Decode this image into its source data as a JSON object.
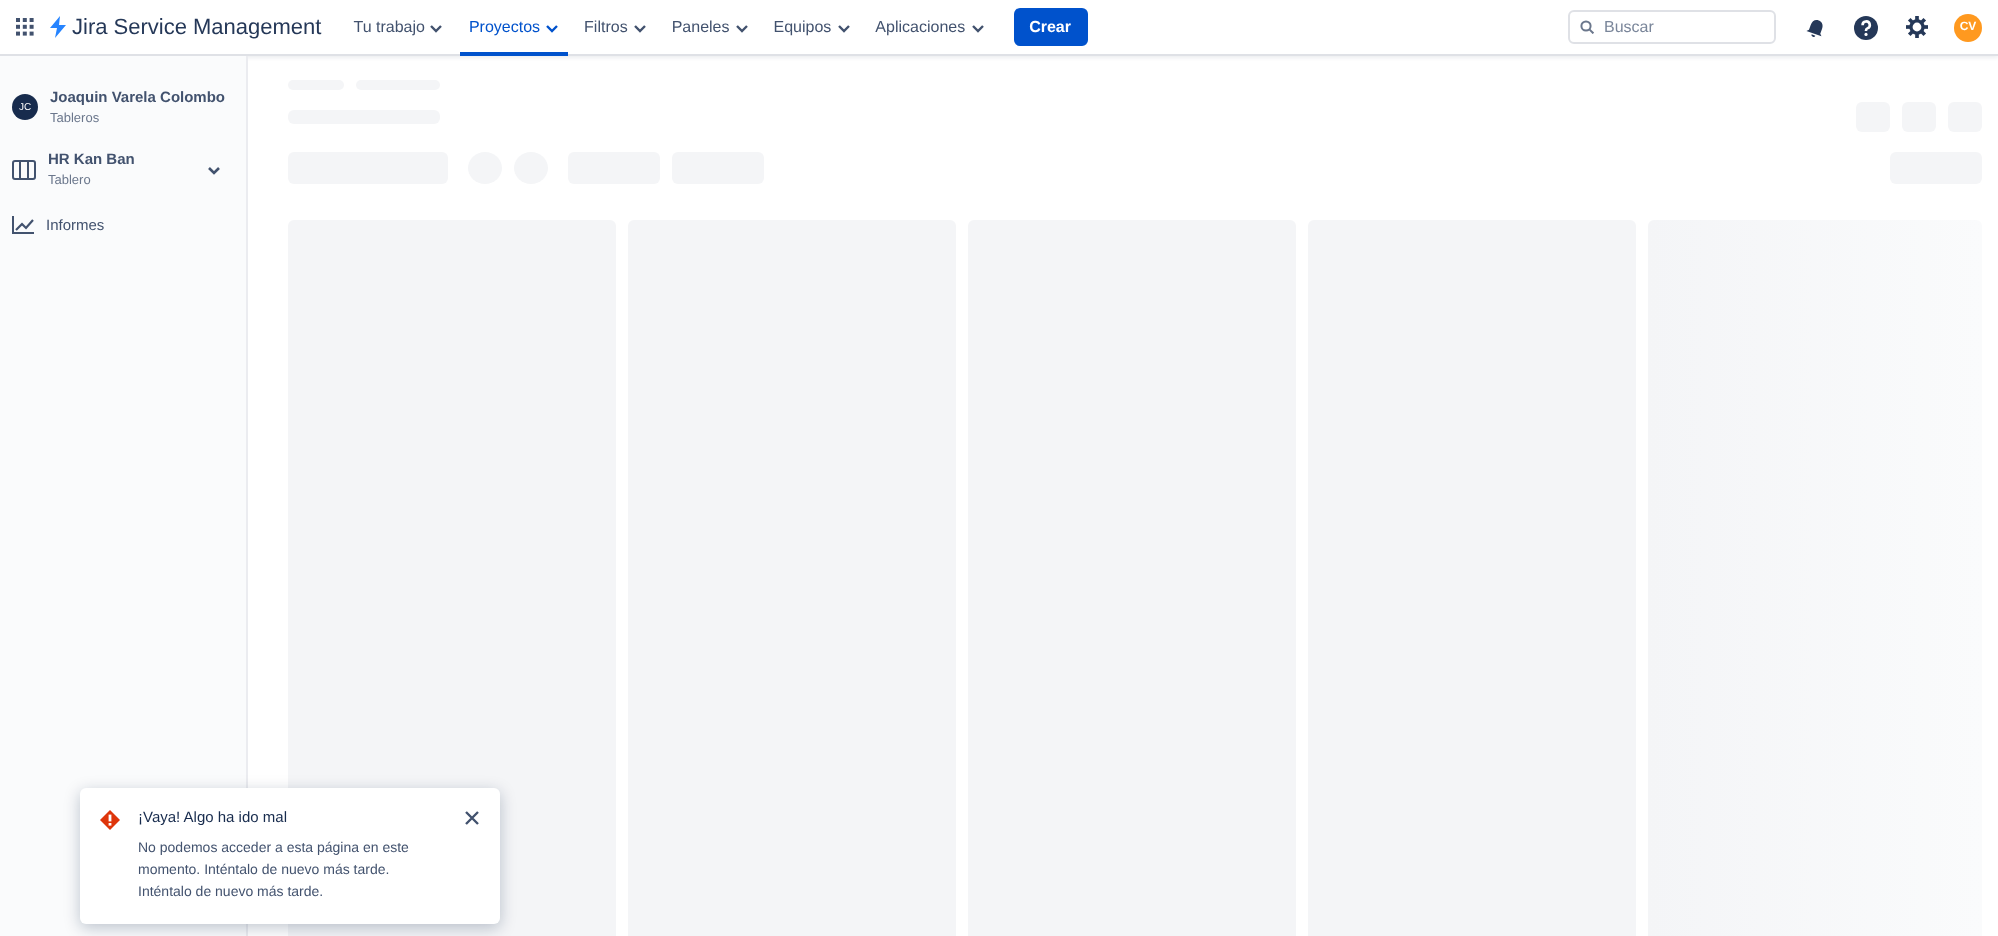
{
  "topbar": {
    "product": "Jira Service Management",
    "nav": [
      {
        "label": "Tu trabajo",
        "selected": false
      },
      {
        "label": "Proyectos",
        "selected": true
      },
      {
        "label": "Filtros",
        "selected": false
      },
      {
        "label": "Paneles",
        "selected": false
      },
      {
        "label": "Equipos",
        "selected": false
      },
      {
        "label": "Aplicaciones",
        "selected": false
      }
    ],
    "create": "Crear",
    "search": {
      "placeholder": "Buscar"
    },
    "avatar": "CV"
  },
  "sidebar": {
    "project": {
      "avatar": "JC",
      "name": "Joaquin Varela Colombo",
      "subtitle": "Tableros"
    },
    "items": [
      {
        "kind": "board",
        "label": "HR Kan Ban",
        "subtitle": "Tablero",
        "expanded": false
      },
      {
        "kind": "reports",
        "label": "Informes"
      }
    ]
  },
  "toast": {
    "title": "¡Vaya! Algo ha ido mal",
    "message": "No podemos acceder a esta página en este momento. Inténtalo de nuevo más tarde. Inténtalo de nuevo más tarde."
  }
}
